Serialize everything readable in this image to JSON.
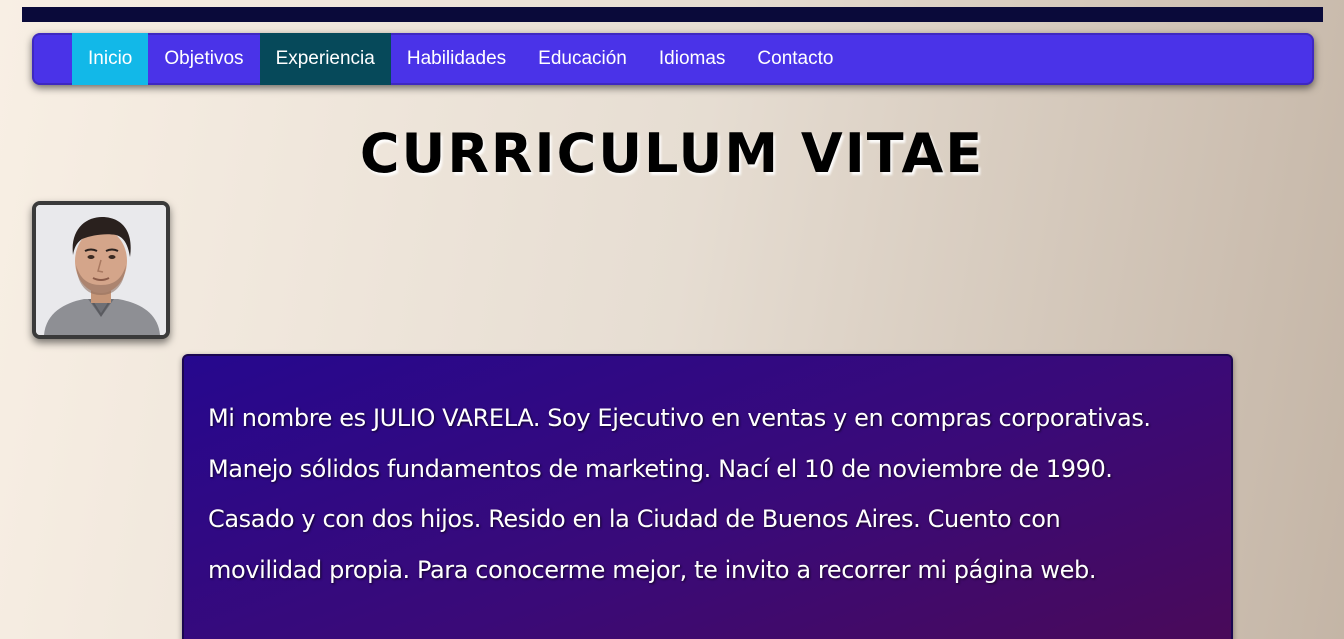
{
  "nav": {
    "items": [
      {
        "label": "Inicio"
      },
      {
        "label": "Objetivos"
      },
      {
        "label": "Experiencia"
      },
      {
        "label": "Habilidades"
      },
      {
        "label": "Educación"
      },
      {
        "label": "Idiomas"
      },
      {
        "label": "Contacto"
      }
    ],
    "active_item": "Inicio",
    "highlighted_item": "Experiencia"
  },
  "header": {
    "title": "CURRICULUM VITAE"
  },
  "profile": {
    "photo_icon": "profile-photo",
    "bio_lines": [
      "Mi nombre es JULIO VARELA. Soy Ejecutivo en ventas y en compras corporativas.",
      "Manejo sólidos fundamentos de marketing. Nací el 10 de noviembre de 1990.",
      "Casado y con dos hijos. Resido en la Ciudad de Buenos Aires. Cuento con",
      "movilidad propia. Para conocerme mejor, te invito a recorrer mi página web."
    ]
  },
  "colors": {
    "top_bar": "#0a0a3a",
    "navbar": "#4a33e8",
    "nav_active": "#12b8e8",
    "nav_highlight": "#06495a",
    "bio_bg_start": "#26088e",
    "bio_bg_end": "#4a0a58"
  }
}
